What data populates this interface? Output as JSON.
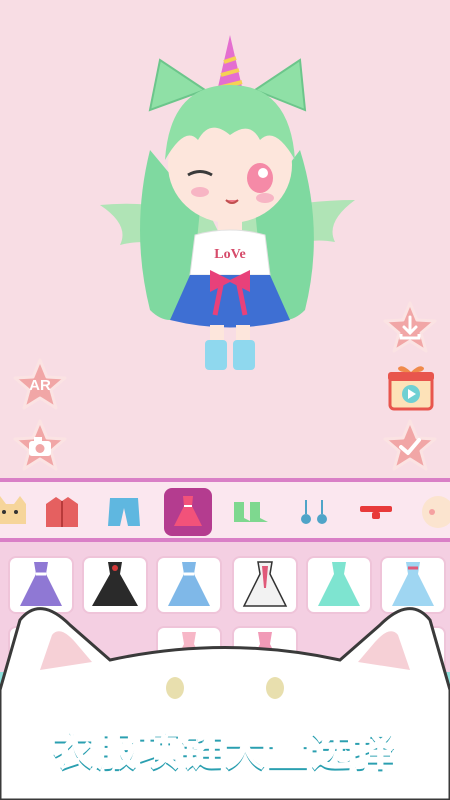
{
  "side_buttons": {
    "ar_label": "AR"
  },
  "categories": [
    {
      "name": "cat-partial-icon"
    },
    {
      "name": "jacket-icon"
    },
    {
      "name": "shorts-icon"
    },
    {
      "name": "dress-icon"
    },
    {
      "name": "socks-icon"
    },
    {
      "name": "earrings-icon"
    },
    {
      "name": "choker-icon"
    },
    {
      "name": "face-icon"
    }
  ],
  "active_category_index": 3,
  "colors": {
    "accent": "#b43c8f",
    "star_button": "#f1a6a6",
    "banner_text": "#3fc7d6"
  },
  "banner": {
    "text": "衣服项链大量选择"
  }
}
